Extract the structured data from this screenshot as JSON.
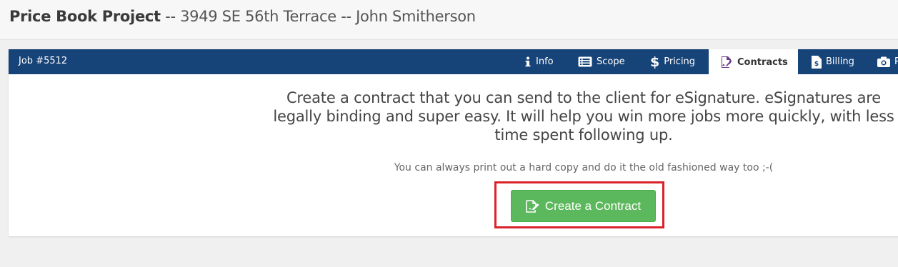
{
  "header": {
    "title_strong": "Price Book Project",
    "title_rest": " -- 3949 SE 56th Terrace -- John Smitherson"
  },
  "panel": {
    "job_label": "Job #5512",
    "tabs": [
      {
        "label": "Info",
        "icon": "info-icon"
      },
      {
        "label": "Scope",
        "icon": "list-icon"
      },
      {
        "label": "Pricing",
        "icon": "dollar-icon"
      },
      {
        "label": "Contracts",
        "icon": "signature-icon",
        "active": true
      },
      {
        "label": "Billing",
        "icon": "invoice-icon"
      },
      {
        "label": "P",
        "icon": "camera-icon"
      }
    ],
    "lead_text": "Create a contract that you can send to the client for eSignature. eSignatures are legally binding and super easy. It will help you win more jobs more quickly, with less time spent following up.",
    "note_text": "You can always print out a hard copy and do it the old fashioned way too ;-(",
    "create_button_label": "Create a Contract",
    "create_button_icon": "contract-edit-icon"
  },
  "colors": {
    "nav_bar": "#164378",
    "button_green": "#5cb85c",
    "highlight_red": "#d9222a"
  }
}
